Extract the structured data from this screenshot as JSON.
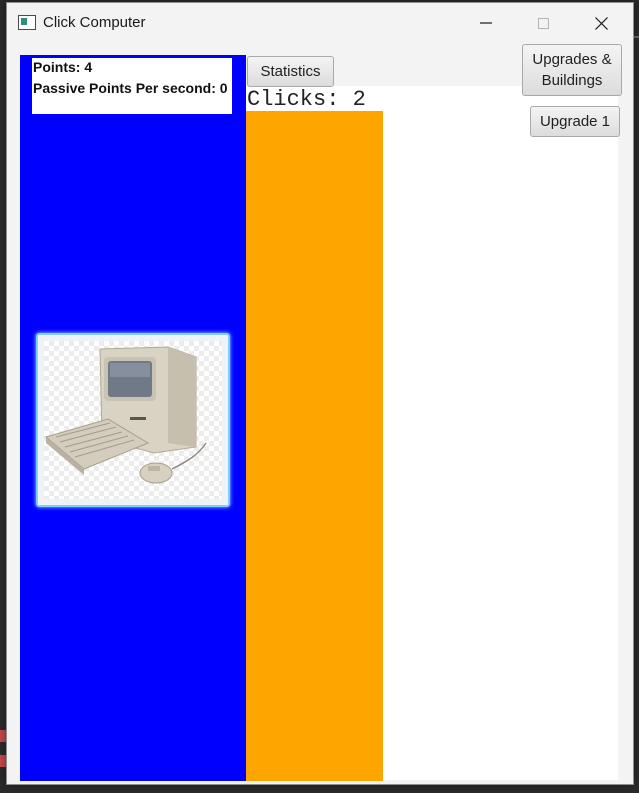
{
  "window": {
    "title": "Click Computer",
    "controls": {
      "minimize": "—",
      "maximize": "□",
      "close": "✕"
    }
  },
  "stats": {
    "points_text": "Points: 4",
    "passive_text": "Passive Points Per second: 0"
  },
  "clicks_text": "Clicks: 2",
  "buttons": {
    "statistics": "Statistics",
    "upgrades_line1": "Upgrades &",
    "upgrades_line2": "Buildings",
    "upgrade1": "Upgrade 1"
  },
  "colors": {
    "left_panel": "#0000ff",
    "middle_panel": "#ffa500",
    "client_bg": "#ffffff"
  },
  "icons": {
    "app": "app-window-icon",
    "clickable_image": "vintage-computer-image"
  }
}
